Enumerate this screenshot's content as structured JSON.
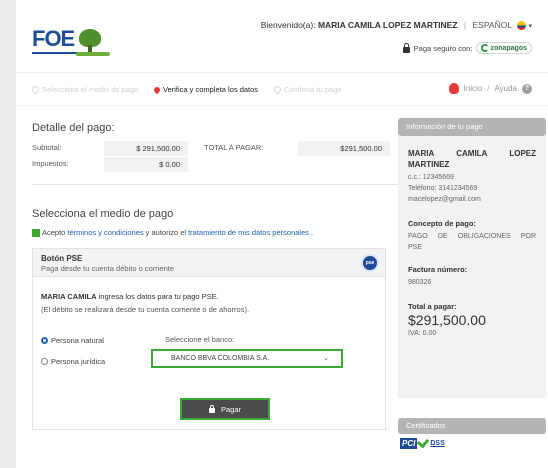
{
  "header": {
    "logo_text": "FOE",
    "welcome_prefix": "Bienvenido(a):",
    "user_name": "MARIA CAMILA LOPEZ MARTINEZ",
    "separator": "|",
    "language": "ESPAÑOL",
    "secure_text": "Paga seguro con:",
    "provider": "zonapagos"
  },
  "steps": [
    {
      "label": "Selecciona el medio de pago"
    },
    {
      "label": "Verifica y completa los datos"
    },
    {
      "label": "Confirma tu pago"
    }
  ],
  "nav": {
    "home": "Inicio",
    "slash": "/",
    "help": "Ayuda"
  },
  "detail": {
    "title": "Detalle del pago:",
    "subtotal_label": "Subtotal:",
    "subtotal_value": "$ 291,500.00",
    "tax_label": "Impuestos:",
    "tax_value": "$ 0.00",
    "total_label": "TOTAL A PAGAR:",
    "total_value": "$291,500.00"
  },
  "method": {
    "title": "Selecciona el medio de pago",
    "terms_prefix": "Acepto",
    "terms_link": "términos y condiciones",
    "terms_mid": "y autorizo el",
    "terms_link2": "tratamiento de mis datos personales",
    "terms_end": "."
  },
  "pse": {
    "title": "Botón PSE",
    "subtitle": "Paga desde tu cuenta débito o corriente",
    "logo": "pse",
    "line1_name": "MARIA CAMILA",
    "line1_rest": "ingresa los datos para tu pago PSE.",
    "line2": "(El débito se realizará desde tu cuenta corriente o de ahorros).",
    "radio_natural": "Persona natural",
    "radio_juridica": "Persona jurídica",
    "bank_label": "Seleccione el banco:",
    "bank_value": "BANCO BBVA COLOMBIA S.A.",
    "pay_button": "Pagar"
  },
  "info": {
    "title": "Información de tu pago",
    "name_line1": "MARIA CAMILA LOPEZ",
    "name_line2": "MARTINEZ",
    "cc": "c.c.: 12345669",
    "phone": "Teléfono: 3141234569",
    "email": "macelopez@gmail.com",
    "concept_label": "Concepto de pago:",
    "concept_line1": "PAGO DE OBLIGACIONES POR",
    "concept_line2": "PSE",
    "invoice_label": "Factura número:",
    "invoice_value": "980326",
    "total_label": "Total a pagar:",
    "total_value": "$291,500.00",
    "iva": "IVA: 0.00"
  },
  "certificates": {
    "title": "Certificados",
    "pci": "PCI",
    "dss": "DSS"
  },
  "colors": {
    "accent_green": "#3aaa35",
    "link_blue": "#1e63b0",
    "brand_blue": "#1f4e96",
    "panel_gray": "#b4b4b4"
  }
}
